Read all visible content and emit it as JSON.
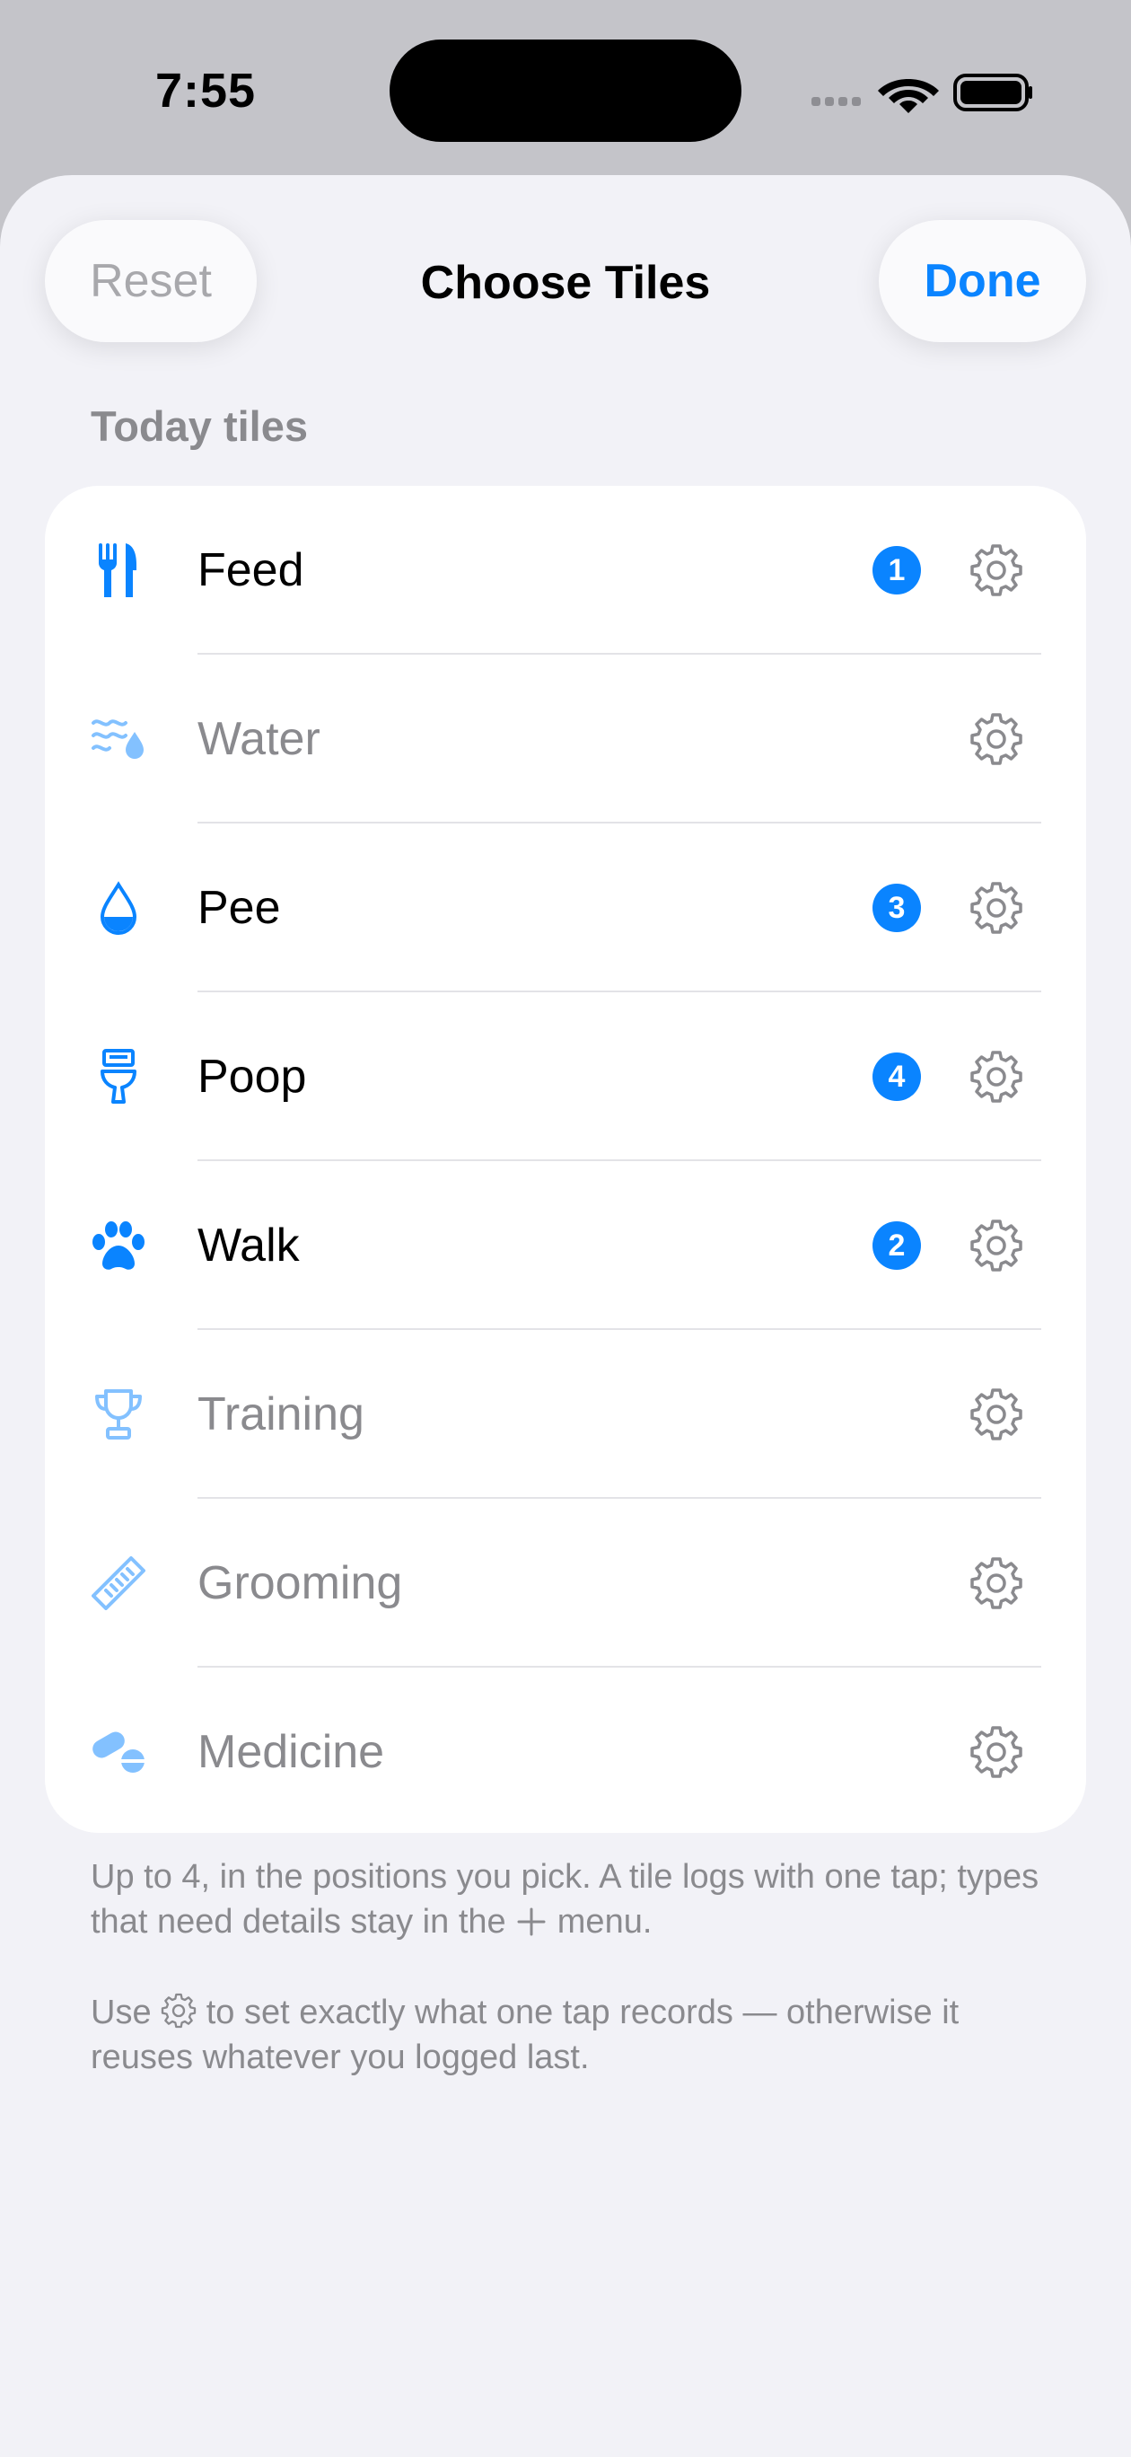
{
  "status_bar": {
    "time": "7:55"
  },
  "header": {
    "reset_label": "Reset",
    "title": "Choose Tiles",
    "done_label": "Done"
  },
  "section": {
    "header": "Today tiles"
  },
  "tiles": [
    {
      "label": "Feed",
      "icon": "fork-knife-icon",
      "active": true,
      "position": "1"
    },
    {
      "label": "Water",
      "icon": "water-drop-waves-icon",
      "active": false,
      "position": ""
    },
    {
      "label": "Pee",
      "icon": "drop-icon",
      "active": true,
      "position": "3"
    },
    {
      "label": "Poop",
      "icon": "toilet-icon",
      "active": true,
      "position": "4"
    },
    {
      "label": "Walk",
      "icon": "paw-icon",
      "active": true,
      "position": "2"
    },
    {
      "label": "Training",
      "icon": "trophy-icon",
      "active": false,
      "position": ""
    },
    {
      "label": "Grooming",
      "icon": "comb-icon",
      "active": false,
      "position": ""
    },
    {
      "label": "Medicine",
      "icon": "pills-icon",
      "active": false,
      "position": ""
    }
  ],
  "footer": {
    "line1_a": "Up to 4, in the positions you pick. A tile logs with one tap; types that need details stay in the",
    "line1_b": "menu.",
    "line2_a": "Use",
    "line2_b": "to set exactly what one tap records — otherwise it reuses whatever you logged last."
  },
  "colors": {
    "accent": "#0a84ff",
    "secondary_text": "#8a8a8e",
    "sheet_background": "#f2f2f7"
  }
}
